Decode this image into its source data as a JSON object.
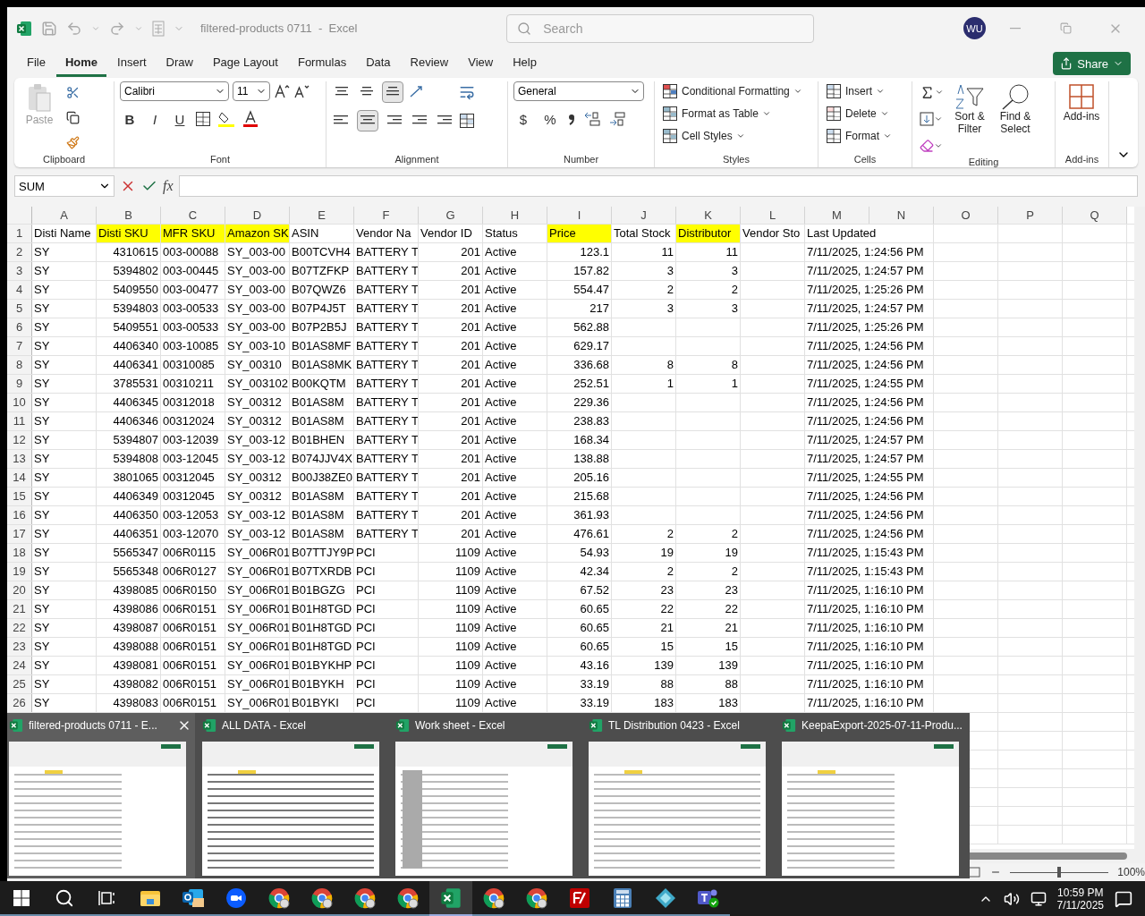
{
  "titlebar": {
    "title": "filtered-products 0711  -  Excel",
    "search_placeholder": "Search",
    "avatar": "WU"
  },
  "menu": [
    {
      "label": "File",
      "selected": false
    },
    {
      "label": "Home",
      "selected": true
    },
    {
      "label": "Insert",
      "selected": false
    },
    {
      "label": "Draw",
      "selected": false
    },
    {
      "label": "Page Layout",
      "selected": false
    },
    {
      "label": "Formulas",
      "selected": false
    },
    {
      "label": "Data",
      "selected": false
    },
    {
      "label": "Review",
      "selected": false
    },
    {
      "label": "View",
      "selected": false
    },
    {
      "label": "Help",
      "selected": false
    }
  ],
  "share": "Share",
  "ribbon": {
    "paste": "Paste",
    "font_name": "Calibri",
    "font_size": "11",
    "bold": "B",
    "italic": "I",
    "underline": "U",
    "number_format": "General",
    "currency": "$",
    "percent": "%",
    "styles": [
      "Conditional Formatting",
      "Format as Table",
      "Cell Styles"
    ],
    "cells": [
      "Insert",
      "Delete",
      "Format"
    ],
    "editing": [
      "Sort & Filter",
      "Find & Select"
    ],
    "addins": "Add-ins",
    "groups": [
      "Clipboard",
      "Font",
      "Alignment",
      "Number",
      "Styles",
      "Cells",
      "Editing",
      "Add-ins"
    ]
  },
  "formula_bar": {
    "name_box": "SUM",
    "fx": "fx"
  },
  "sheet": {
    "columns": [
      {
        "letter": "A",
        "kind": "text"
      },
      {
        "letter": "B",
        "kind": "number"
      },
      {
        "letter": "C",
        "kind": "text"
      },
      {
        "letter": "D",
        "kind": "text"
      },
      {
        "letter": "E",
        "kind": "text"
      },
      {
        "letter": "F",
        "kind": "text"
      },
      {
        "letter": "G",
        "kind": "number"
      },
      {
        "letter": "H",
        "kind": "text"
      },
      {
        "letter": "I",
        "kind": "number"
      },
      {
        "letter": "J",
        "kind": "number"
      },
      {
        "letter": "K",
        "kind": "number"
      },
      {
        "letter": "L"
      },
      {
        "letter": "M",
        "kind": "text"
      },
      {
        "letter": "N"
      },
      {
        "letter": "O"
      },
      {
        "letter": "P"
      },
      {
        "letter": "Q"
      }
    ],
    "header": {
      "n": "1",
      "cells": [
        {
          "text": "Disti Name",
          "highlight": false
        },
        {
          "text": "Disti SKU",
          "highlight": true
        },
        {
          "text": "MFR SKU",
          "highlight": true
        },
        {
          "text": "Amazon SK",
          "highlight": true
        },
        {
          "text": "ASIN",
          "highlight": false
        },
        {
          "text": "Vendor Na",
          "highlight": false
        },
        {
          "text": "Vendor ID",
          "highlight": false
        },
        {
          "text": "Status",
          "highlight": false
        },
        {
          "text": "Price",
          "highlight": true
        },
        {
          "text": "Total Stock",
          "highlight": false
        },
        {
          "text": "Distributor",
          "highlight": true
        },
        {
          "text": "Vendor Sto",
          "highlight": false
        },
        {
          "text": "Last Updated",
          "highlight": false
        }
      ]
    },
    "rows": [
      {
        "n": "2",
        "cells": [
          "SY",
          "4310615",
          "003-00088",
          "SY_003-00",
          "B00TCVH4",
          "BATTERY T",
          "201",
          "Active",
          "123.1",
          "11",
          "11",
          null,
          "7/11/2025, 1:24:56 PM"
        ]
      },
      {
        "n": "3",
        "cells": [
          "SY",
          "5394802",
          "003-00445",
          "SY_003-00",
          "B07TZFKP",
          "BATTERY T",
          "201",
          "Active",
          "157.82",
          "3",
          "3",
          null,
          "7/11/2025, 1:24:57 PM"
        ]
      },
      {
        "n": "4",
        "cells": [
          "SY",
          "5409550",
          "003-00477",
          "SY_003-00",
          "B07QWZ6",
          "BATTERY T",
          "201",
          "Active",
          "554.47",
          "2",
          "2",
          null,
          "7/11/2025, 1:25:26 PM"
        ]
      },
      {
        "n": "5",
        "cells": [
          "SY",
          "5394803",
          "003-00533",
          "SY_003-00",
          "B07P4J5T",
          "BATTERY T",
          "201",
          "Active",
          "217",
          "3",
          "3",
          null,
          "7/11/2025, 1:24:57 PM"
        ]
      },
      {
        "n": "6",
        "cells": [
          "SY",
          "5409551",
          "003-00533",
          "SY_003-00",
          "B07P2B5J",
          "BATTERY T",
          "201",
          "Active",
          "562.88",
          null,
          null,
          null,
          "7/11/2025, 1:25:26 PM"
        ]
      },
      {
        "n": "7",
        "cells": [
          "SY",
          "4406340",
          "003-10085",
          "SY_003-10",
          "B01AS8MF",
          "BATTERY T",
          "201",
          "Active",
          "629.17",
          null,
          null,
          null,
          "7/11/2025, 1:24:56 PM"
        ]
      },
      {
        "n": "8",
        "cells": [
          "SY",
          "4406341",
          "00310085",
          "SY_00310",
          "B01AS8MK",
          "BATTERY T",
          "201",
          "Active",
          "336.68",
          "8",
          "8",
          null,
          "7/11/2025, 1:24:56 PM"
        ]
      },
      {
        "n": "9",
        "cells": [
          "SY",
          "3785531",
          "00310211",
          "SY_003102",
          "B00KQTM",
          "BATTERY T",
          "201",
          "Active",
          "252.51",
          "1",
          "1",
          null,
          "7/11/2025, 1:24:55 PM"
        ]
      },
      {
        "n": "10",
        "cells": [
          "SY",
          "4406345",
          "00312018",
          "SY_00312",
          "B01AS8M",
          "BATTERY T",
          "201",
          "Active",
          "229.36",
          null,
          null,
          null,
          "7/11/2025, 1:24:56 PM"
        ]
      },
      {
        "n": "11",
        "cells": [
          "SY",
          "4406346",
          "00312024",
          "SY_00312",
          "B01AS8M",
          "BATTERY T",
          "201",
          "Active",
          "238.83",
          null,
          null,
          null,
          "7/11/2025, 1:24:56 PM"
        ]
      },
      {
        "n": "12",
        "cells": [
          "SY",
          "5394807",
          "003-12039",
          "SY_003-12",
          "B01BHEN",
          "BATTERY T",
          "201",
          "Active",
          "168.34",
          null,
          null,
          null,
          "7/11/2025, 1:24:57 PM"
        ]
      },
      {
        "n": "13",
        "cells": [
          "SY",
          "5394808",
          "003-12045",
          "SY_003-12",
          "B074JJV4X",
          "BATTERY T",
          "201",
          "Active",
          "138.88",
          null,
          null,
          null,
          "7/11/2025, 1:24:57 PM"
        ]
      },
      {
        "n": "14",
        "cells": [
          "SY",
          "3801065",
          "00312045",
          "SY_00312",
          "B00J38ZE0",
          "BATTERY T",
          "201",
          "Active",
          "205.16",
          null,
          null,
          null,
          "7/11/2025, 1:24:55 PM"
        ]
      },
      {
        "n": "15",
        "cells": [
          "SY",
          "4406349",
          "00312045",
          "SY_00312",
          "B01AS8M",
          "BATTERY T",
          "201",
          "Active",
          "215.68",
          null,
          null,
          null,
          "7/11/2025, 1:24:56 PM"
        ]
      },
      {
        "n": "16",
        "cells": [
          "SY",
          "4406350",
          "003-12053",
          "SY_003-12",
          "B01AS8M",
          "BATTERY T",
          "201",
          "Active",
          "361.93",
          null,
          null,
          null,
          "7/11/2025, 1:24:56 PM"
        ]
      },
      {
        "n": "17",
        "cells": [
          "SY",
          "4406351",
          "003-12070",
          "SY_003-12",
          "B01AS8M",
          "BATTERY T",
          "201",
          "Active",
          "476.61",
          "2",
          "2",
          null,
          "7/11/2025, 1:24:56 PM"
        ]
      },
      {
        "n": "18",
        "cells": [
          "SY",
          "5565347",
          "006R0115",
          "SY_006R01",
          "B07TTJY9P",
          "PCI",
          "1109",
          "Active",
          "54.93",
          "19",
          "19",
          null,
          "7/11/2025, 1:15:43 PM"
        ]
      },
      {
        "n": "19",
        "cells": [
          "SY",
          "5565348",
          "006R0127",
          "SY_006R01",
          "B07TXRDB",
          "PCI",
          "1109",
          "Active",
          "42.34",
          "2",
          "2",
          null,
          "7/11/2025, 1:15:43 PM"
        ]
      },
      {
        "n": "20",
        "cells": [
          "SY",
          "4398085",
          "006R0150",
          "SY_006R01",
          "B01BGZG",
          "PCI",
          "1109",
          "Active",
          "67.52",
          "23",
          "23",
          null,
          "7/11/2025, 1:16:10 PM"
        ]
      },
      {
        "n": "21",
        "cells": [
          "SY",
          "4398086",
          "006R0151",
          "SY_006R01",
          "B01H8TGD",
          "PCI",
          "1109",
          "Active",
          "60.65",
          "22",
          "22",
          null,
          "7/11/2025, 1:16:10 PM"
        ]
      },
      {
        "n": "22",
        "cells": [
          "SY",
          "4398087",
          "006R0151",
          "SY_006R01",
          "B01H8TGD",
          "PCI",
          "1109",
          "Active",
          "60.65",
          "21",
          "21",
          null,
          "7/11/2025, 1:16:10 PM"
        ]
      },
      {
        "n": "23",
        "cells": [
          "SY",
          "4398088",
          "006R0151",
          "SY_006R01",
          "B01H8TGD",
          "PCI",
          "1109",
          "Active",
          "60.65",
          "15",
          "15",
          null,
          "7/11/2025, 1:16:10 PM"
        ]
      },
      {
        "n": "24",
        "cells": [
          "SY",
          "4398081",
          "006R0151",
          "SY_006R01",
          "B01BYKHP",
          "PCI",
          "1109",
          "Active",
          "43.16",
          "139",
          "139",
          null,
          "7/11/2025, 1:16:10 PM"
        ]
      },
      {
        "n": "25",
        "cells": [
          "SY",
          "4398082",
          "006R0151",
          "SY_006R01",
          "B01BYKH",
          "PCI",
          "1109",
          "Active",
          "33.19",
          "88",
          "88",
          null,
          "7/11/2025, 1:16:10 PM"
        ]
      },
      {
        "n": "26",
        "cells": [
          "SY",
          "4398083",
          "006R0151",
          "SY_006R01",
          "B01BYKI",
          "PCI",
          "1109",
          "Active",
          "33.19",
          "183",
          "183",
          null,
          "7/11/2025, 1:16:10 PM"
        ]
      }
    ]
  },
  "status_bar": {
    "zoom": "100%",
    "zoom_slider": {
      "level": 0.5
    }
  },
  "switcher": [
    {
      "title": "filtered-products 0711 - E...",
      "selected": true
    },
    {
      "title": "ALL DATA - Excel",
      "selected": false
    },
    {
      "title": "Work sheet - Excel",
      "selected": false
    },
    {
      "title": "TL Distribution 0423 - Excel",
      "selected": false
    },
    {
      "title": "KeepaExport-2025-07-11-Produ...",
      "selected": false
    }
  ],
  "taskbar": {
    "apps": [
      {
        "kind": "explorer",
        "active": false
      },
      {
        "kind": "outlook",
        "active": false
      },
      {
        "kind": "zoom",
        "active": false
      },
      {
        "kind": "chrome",
        "active": false
      },
      {
        "kind": "chrome",
        "active": false
      },
      {
        "kind": "chrome",
        "active": false
      },
      {
        "kind": "chrome",
        "active": false
      },
      {
        "kind": "excel",
        "active": true
      },
      {
        "kind": "chrome",
        "active": false
      },
      {
        "kind": "chrome",
        "active": false
      },
      {
        "kind": "filezilla",
        "active": false
      },
      {
        "kind": "calculator",
        "active": false
      },
      {
        "kind": "diamond",
        "active": false
      },
      {
        "kind": "teams",
        "active": false
      }
    ],
    "time": "10:59 PM",
    "date": "7/11/2025"
  }
}
